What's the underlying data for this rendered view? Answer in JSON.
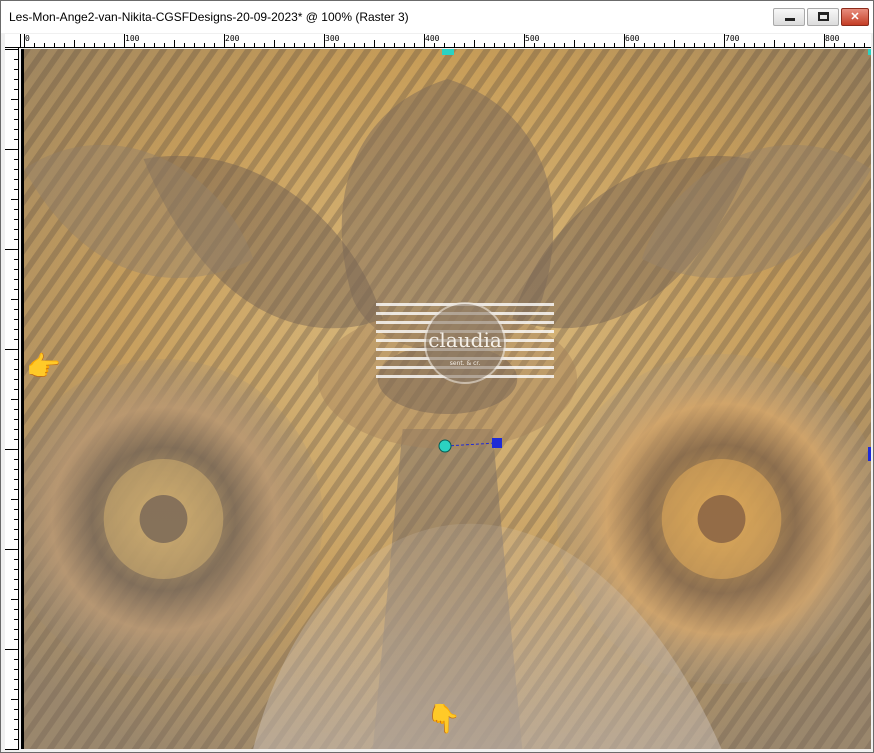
{
  "window": {
    "title": "Les-Mon-Ange2-van-Nikita-CGSFDesigns-20-09-2023* @ 100% (Raster 3)"
  },
  "ruler": {
    "labels": [
      "0",
      "100",
      "200",
      "300",
      "400",
      "500",
      "600",
      "700",
      "800"
    ]
  },
  "watermark": {
    "brand": "claudia",
    "sub": "sent. & cr."
  },
  "pointers": {
    "left_hand": "👉",
    "bottom_hand": "👇"
  },
  "colors": {
    "accent_marker": "#2bd3c2",
    "blue_marker": "#1e2bd6",
    "pointer_yellow": "#f4c300"
  }
}
